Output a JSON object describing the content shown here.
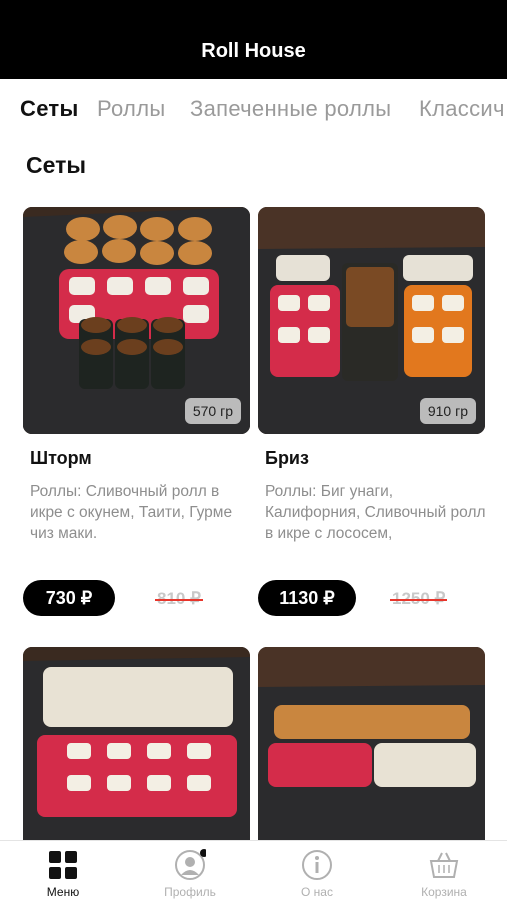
{
  "header": {
    "title": "Roll House"
  },
  "tabs": [
    {
      "label": "Сеты"
    },
    {
      "label": "Роллы"
    },
    {
      "label": "Запеченные роллы"
    },
    {
      "label": "Классич"
    }
  ],
  "section": {
    "title": "Сеты"
  },
  "cards": [
    {
      "name": "Шторм",
      "weight": "570 гр",
      "description": "Роллы: Сливочный ролл в икре с окунем, Таити, Гурме чиз маки.",
      "price": "730 ₽",
      "old_price": "810 ₽"
    },
    {
      "name": "Бриз",
      "weight": "910 гр",
      "description": "Роллы: Биг унаги, Калифорния, Сливочный ролл в икре с лососем,",
      "price": "1130 ₽",
      "old_price": "1250 ₽"
    },
    {
      "name": "",
      "weight": "",
      "description": "",
      "price": "",
      "old_price": ""
    },
    {
      "name": "",
      "weight": "",
      "description": "",
      "price": "",
      "old_price": ""
    }
  ],
  "nav": [
    {
      "label": "Меню",
      "icon": "menu-grid-icon"
    },
    {
      "label": "Профиль",
      "icon": "profile-icon"
    },
    {
      "label": "О нас",
      "icon": "info-icon"
    },
    {
      "label": "Корзина",
      "icon": "basket-icon"
    }
  ],
  "colors": {
    "accent": "#000000",
    "strike": "#e8352b",
    "muted": "#9a9a9a"
  }
}
